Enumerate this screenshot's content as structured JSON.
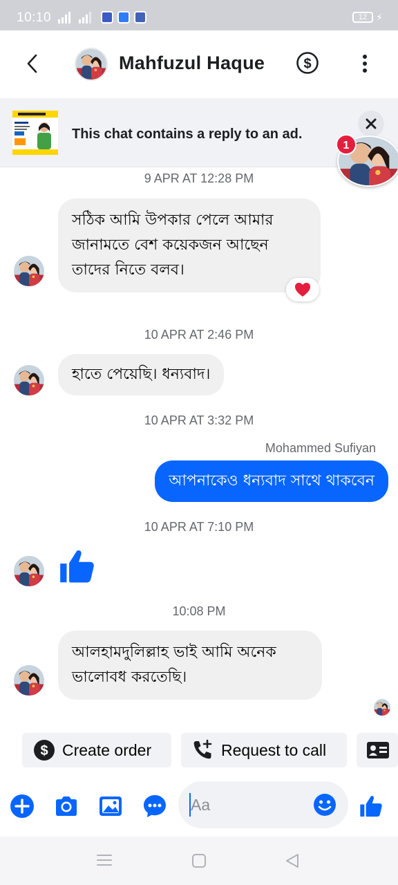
{
  "status_bar": {
    "time": "10:10",
    "battery": "12"
  },
  "header": {
    "contact_name": "Mahfuzul Haque"
  },
  "ad_banner": {
    "text": "This chat contains a reply to an ad."
  },
  "chat_head": {
    "badge_count": "1"
  },
  "messages": [
    {
      "timestamp": "9 APR AT 12:28 PM",
      "lines": [
        "সঠিক আমি উপকার পেলে আমার",
        "জানামতে বেশ কয়েকজন আছেন",
        "তাদের নিতে বলব।"
      ]
    },
    {
      "timestamp": "10 APR AT 2:46 PM",
      "text": "হাতে পেয়েছি। ধন্যবাদ।"
    },
    {
      "timestamp": "10 APR AT 3:32 PM",
      "sender": "Mohammed Sufiyan",
      "text": "আপনাকেও ধন্যবাদ সাথে থাকবেন"
    },
    {
      "timestamp": "10 APR AT 7:10 PM"
    },
    {
      "timestamp": "10:08 PM",
      "lines": [
        "আলহামদুলিল্লাহ ভাই আমি অনেক",
        "ভালোবধ করতেছি।"
      ]
    }
  ],
  "quick_actions": {
    "create_order": "Create order",
    "request_call": "Request to call"
  },
  "composer": {
    "placeholder": "Aa"
  },
  "colors": {
    "accent": "#0866ff",
    "bubble_incoming": "#f0f0f0",
    "reaction_heart": "#e41e3f"
  },
  "icons": [
    "back-arrow-icon",
    "dollar-icon",
    "more-vertical-icon",
    "close-icon",
    "heart-icon",
    "thumbs-up-icon",
    "plus-icon",
    "camera-icon",
    "image-icon",
    "chat-bubble-icon",
    "emoji-icon",
    "phone-icon",
    "id-card-icon"
  ]
}
